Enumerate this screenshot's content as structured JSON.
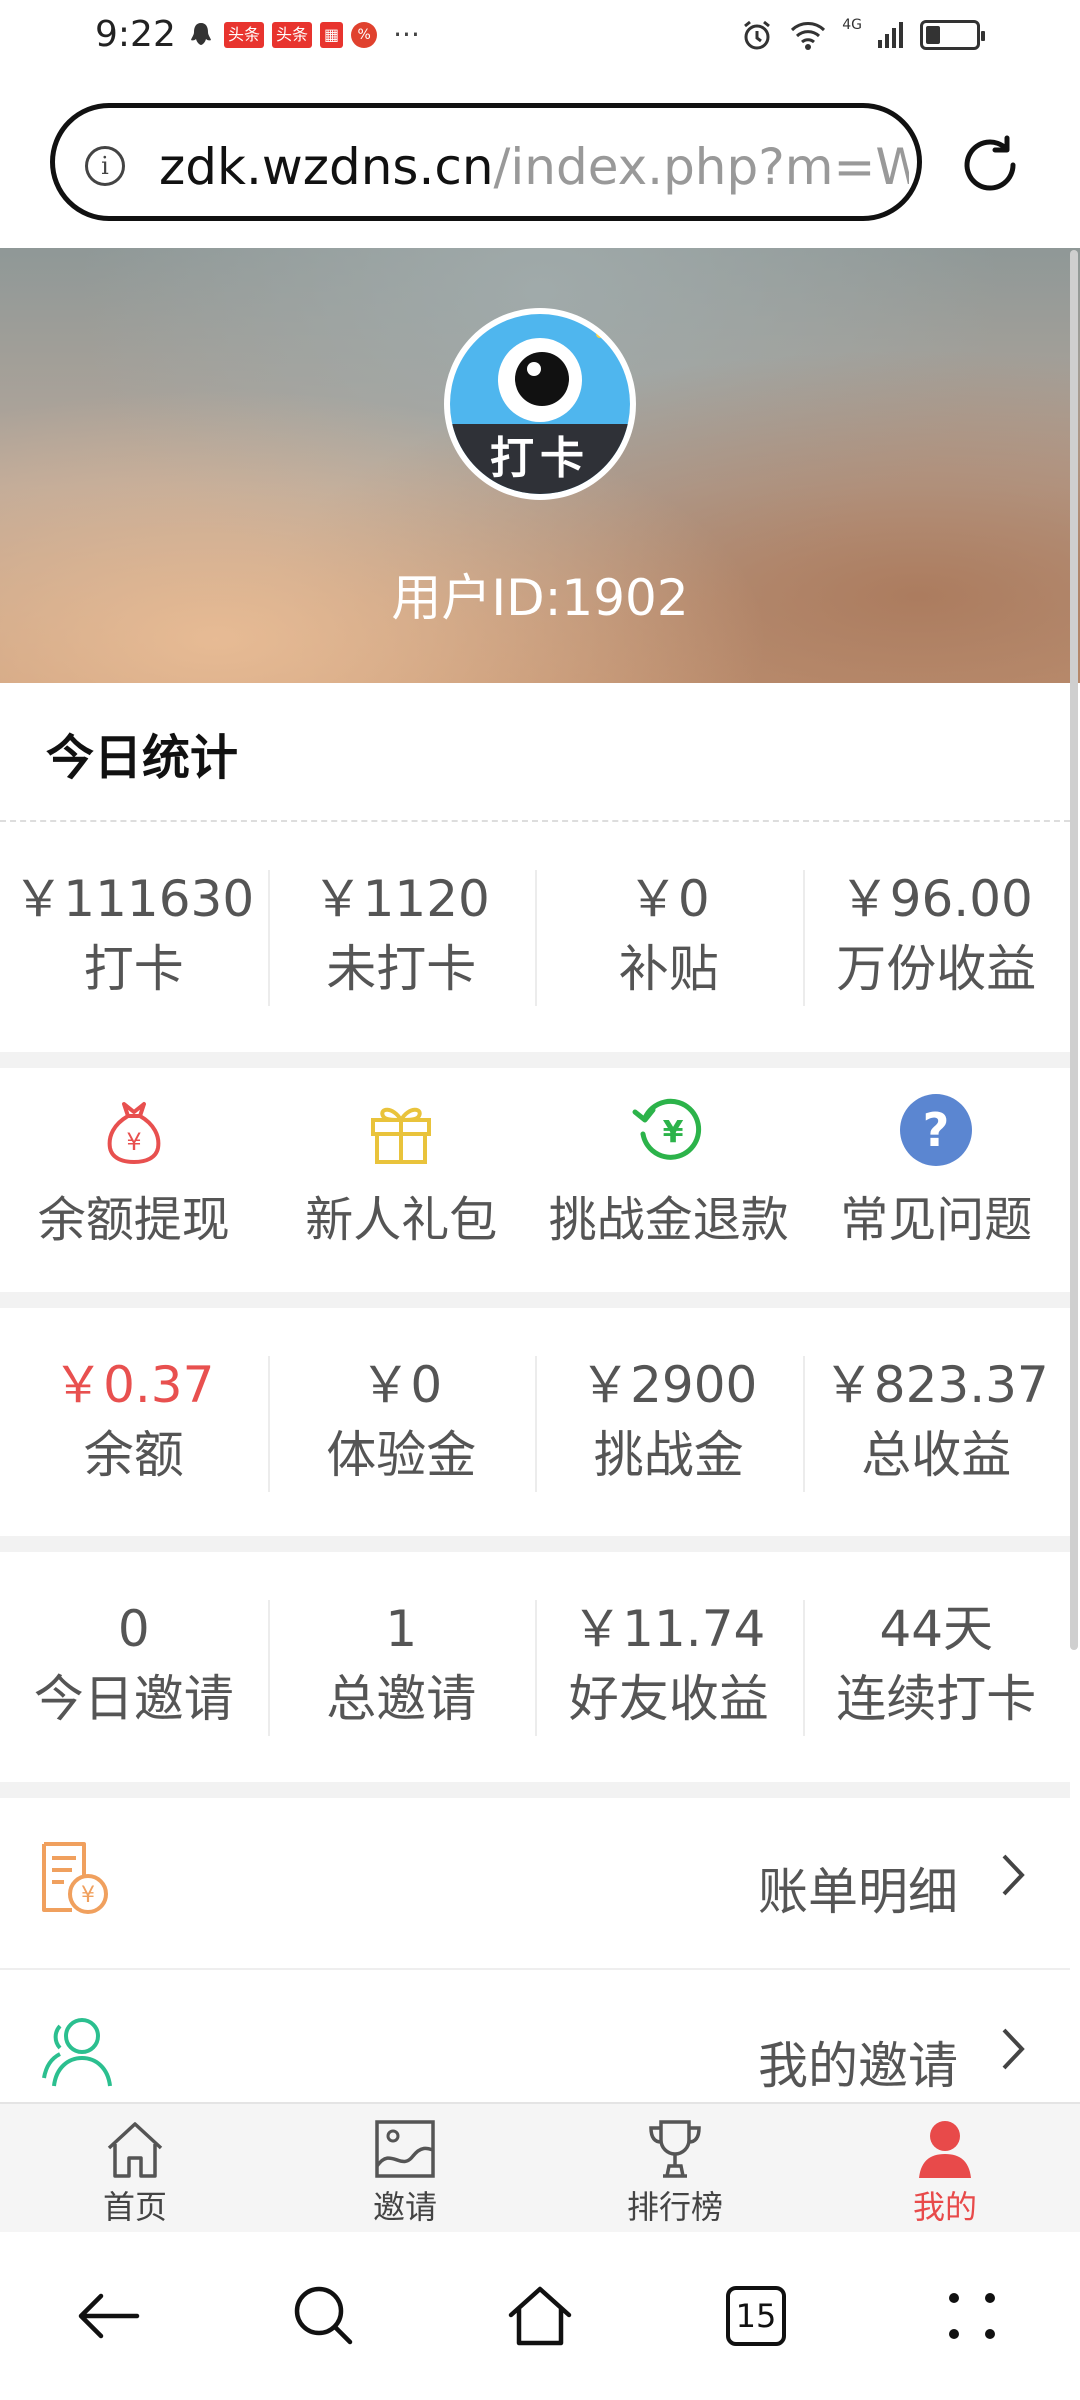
{
  "status_bar": {
    "time": "9:22",
    "badges": [
      "头条",
      "头条"
    ],
    "more": "···",
    "network": "4G",
    "battery_level": 0.3
  },
  "browser": {
    "url_domain": "zdk.wzdns.cn",
    "url_path": "/index.php?m=W",
    "tab_count": "15"
  },
  "profile": {
    "avatar_text": "打卡",
    "user_id": "用户ID:1902"
  },
  "today": {
    "title": "今日统计",
    "stats": [
      {
        "value": "￥111630",
        "label": "打卡"
      },
      {
        "value": "￥1120",
        "label": "未打卡"
      },
      {
        "value": "￥0",
        "label": "补贴"
      },
      {
        "value": "￥96.00",
        "label": "万份收益"
      }
    ]
  },
  "actions": [
    {
      "label": "余额提现",
      "icon": "money-bag-icon",
      "color": "#e8504f"
    },
    {
      "label": "新人礼包",
      "icon": "gift-icon",
      "color": "#e9c33b"
    },
    {
      "label": "挑战金退款",
      "icon": "refund-icon",
      "color": "#2cb34a"
    },
    {
      "label": "常见问题",
      "icon": "question-icon",
      "color": "#5b86d1"
    }
  ],
  "wallet": [
    {
      "value": "￥0.37",
      "label": "余额"
    },
    {
      "value": "￥0",
      "label": "体验金"
    },
    {
      "value": "￥2900",
      "label": "挑战金"
    },
    {
      "value": "￥823.37",
      "label": "总收益"
    }
  ],
  "invite_stats": [
    {
      "value": "0",
      "label": "今日邀请"
    },
    {
      "value": "1",
      "label": "总邀请"
    },
    {
      "value": "￥11.74",
      "label": "好友收益"
    },
    {
      "value": "44天",
      "label": "连续打卡"
    }
  ],
  "menu": [
    {
      "label": "账单明细",
      "icon": "bill-icon"
    },
    {
      "label": "我的邀请",
      "icon": "users-icon"
    }
  ],
  "tabs": [
    {
      "label": "首页",
      "icon": "home-icon"
    },
    {
      "label": "邀请",
      "icon": "image-icon"
    },
    {
      "label": "排行榜",
      "icon": "trophy-icon"
    },
    {
      "label": "我的",
      "icon": "person-icon",
      "active": true
    }
  ],
  "colors": {
    "accent_red": "#e84a4a",
    "text_gray": "#555555"
  }
}
